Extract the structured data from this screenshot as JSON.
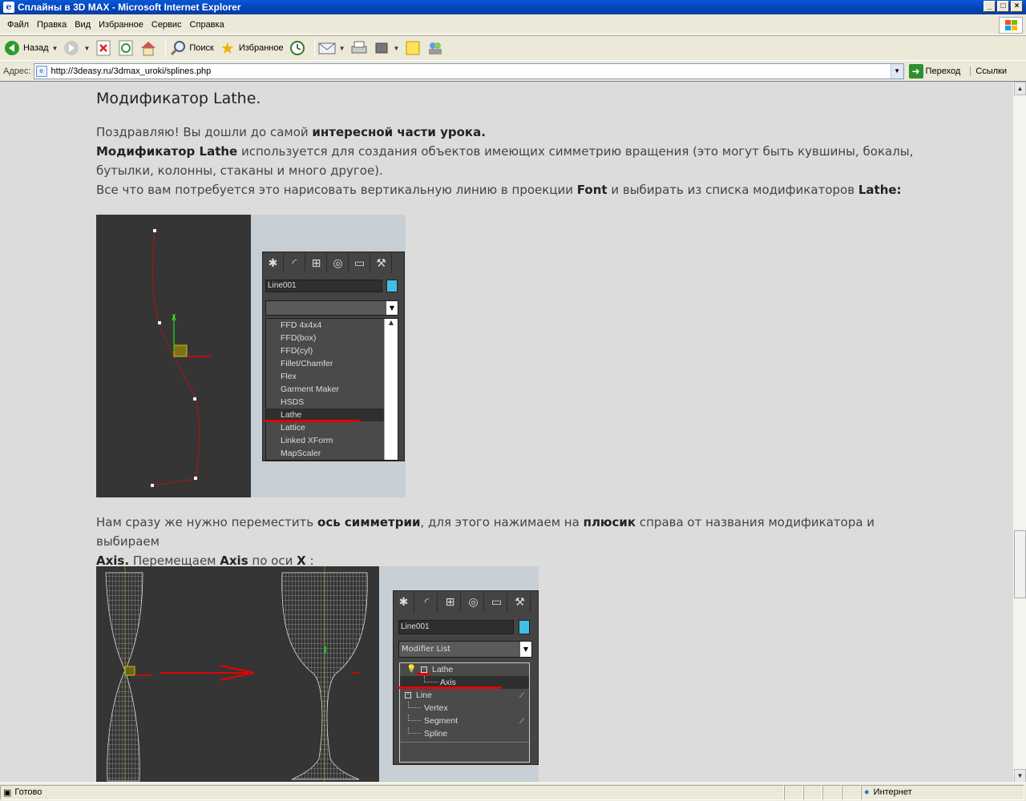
{
  "window": {
    "title": "Сплайны в 3D MAX - Microsoft Internet Explorer"
  },
  "menu": [
    "Файл",
    "Правка",
    "Вид",
    "Избранное",
    "Сервис",
    "Справка"
  ],
  "toolbar": {
    "back": "Назад",
    "search": "Поиск",
    "favorites": "Избранное"
  },
  "address": {
    "label": "Адрес:",
    "url": "http://3deasy.ru/3dmax_uroki/splines.php",
    "go": "Переход",
    "links": "Ссылки"
  },
  "page": {
    "heading": "Модификатор Lathe.",
    "p1": {
      "t1": "Поздравляю! Вы дошли до самой ",
      "b1": "интересной части урока."
    },
    "p2": {
      "b1": "Модификатор Lathe",
      "t1": " используется для создания объектов имеющих симметрию вращения (это могут быть кувшины, бокалы,",
      "t2": "бутылки, колонны, стаканы и много другое)."
    },
    "p3": {
      "t1": "Все что вам потребуется это нарисовать вертикальную линию в проекции ",
      "b1": "Font",
      "t2": " и выбирать из списка модификаторов ",
      "b2": "Lathe:"
    },
    "p4": {
      "t1": "Нам сразу же нужно переместить ",
      "b1": "ось симметрии",
      "t2": ", для этого нажимаем на ",
      "b2": "плюсик",
      "t3": " справа от названия модификатора и выбираем",
      "b3": "Axis.",
      "t4": " Перемещаем ",
      "b4": "Axis",
      "t5": " по оси ",
      "b5": "X",
      "t6": " :"
    }
  },
  "figure1": {
    "object_name": "Line001",
    "axis_label": "y",
    "modifiers": [
      "FFD 4x4x4",
      "FFD(box)",
      "FFD(cyl)",
      "Fillet/Chamfer",
      "Flex",
      "Garment Maker",
      "HSDS",
      "Lathe",
      "Lattice",
      "Linked XForm",
      "MapScaler"
    ],
    "selected": "Lathe"
  },
  "figure2": {
    "object_name": "Line001",
    "modifier_list": "Modifier List",
    "stack": [
      {
        "label": "Lathe",
        "level": 0
      },
      {
        "label": "Axis",
        "level": 1
      },
      {
        "label": "Line",
        "level": 0
      },
      {
        "label": "Vertex",
        "level": 1
      },
      {
        "label": "Segment",
        "level": 1
      },
      {
        "label": "Spline",
        "level": 1
      }
    ]
  },
  "status": {
    "left": "Готово",
    "zone": "Интернет"
  },
  "colors": {
    "accent_red": "#e60000",
    "swatch": "#3fc1e6"
  }
}
